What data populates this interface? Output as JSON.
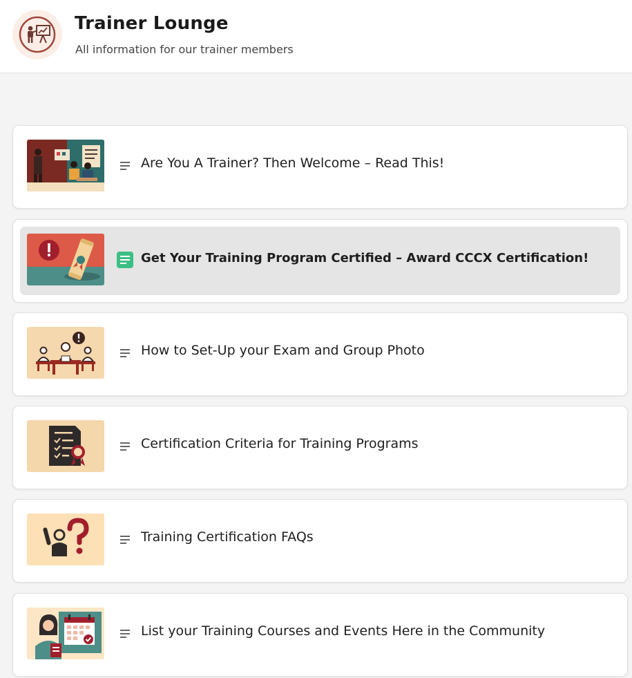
{
  "header": {
    "title": "Trainer Lounge",
    "subtitle": "All information for our trainer members",
    "avatar_icon": "presenter-board-icon",
    "avatar_bg": "#fbeee6",
    "accent_color": "#a0463c"
  },
  "list": {
    "items": [
      {
        "title": "Are You A Trainer? Then Welcome – Read This!",
        "thumbnail": "trainer-classroom-illustration",
        "icon": "document-lines-icon",
        "active": false
      },
      {
        "title": "Get Your Training Program Certified – Award CCCX Certification!",
        "thumbnail": "certificate-scroll-illustration",
        "icon": "document-lines-icon",
        "active": true
      },
      {
        "title": "How to Set-Up your Exam and Group Photo",
        "thumbnail": "exam-room-illustration",
        "icon": "document-lines-icon",
        "active": false
      },
      {
        "title": "Certification Criteria for Training Programs",
        "thumbnail": "checklist-clipboard-illustration",
        "icon": "document-lines-icon",
        "active": false
      },
      {
        "title": "Training Certification FAQs",
        "thumbnail": "question-person-illustration",
        "icon": "document-lines-icon",
        "active": false
      },
      {
        "title": "List your Training Courses and Events Here in the Community",
        "thumbnail": "calendar-event-illustration",
        "icon": "document-lines-icon",
        "active": false
      }
    ],
    "active_icon_color": "#3dbf84",
    "active_row_bg": "#e5e5e5"
  }
}
